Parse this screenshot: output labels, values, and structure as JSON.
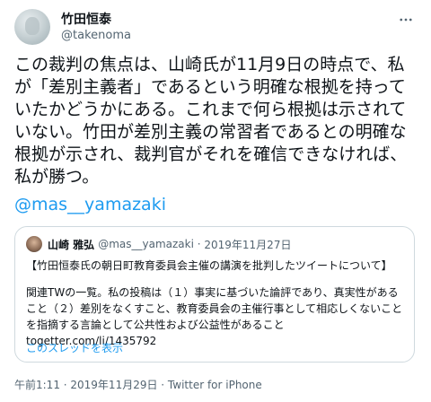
{
  "tweet": {
    "author_name": "竹田恒泰",
    "author_handle": "@takenoma",
    "text": "この裁判の焦点は、山崎氏が11月9日の時点で、私が「差別主義者」であるという明確な根拠を持っていたかどうかにある。これまで何ら根拠は示されていない。竹田が差別主義の常習者であるとの明確な根拠が示され、裁判官がそれを確信できなければ、私が勝つ。",
    "mention": "@mas__yamazaki",
    "footer": "午前1:11 · 2019年11月29日 · Twitter for iPhone"
  },
  "quote": {
    "name": "山崎 雅弘",
    "handle": "@mas__yamazaki",
    "date": "2019年11月27日",
    "line1": "【竹田恒泰氏の朝日町教育委員会主催の講演を批判したツイートについて】",
    "body": "関連TWの一覧。私の投稿は（１）事実に基づいた論評であり、真実性があること（２）差別をなくすこと、教育委員会の主催行事として相応しくないことを指摘する言論として公共性および公益性があること\ntogetter.com/li/1435792",
    "thread_link": "このスレッドを表示"
  },
  "icons": {
    "more": "more-horizontal-icon"
  },
  "colors": {
    "accent": "#1d9bf0",
    "muted": "#536471"
  }
}
